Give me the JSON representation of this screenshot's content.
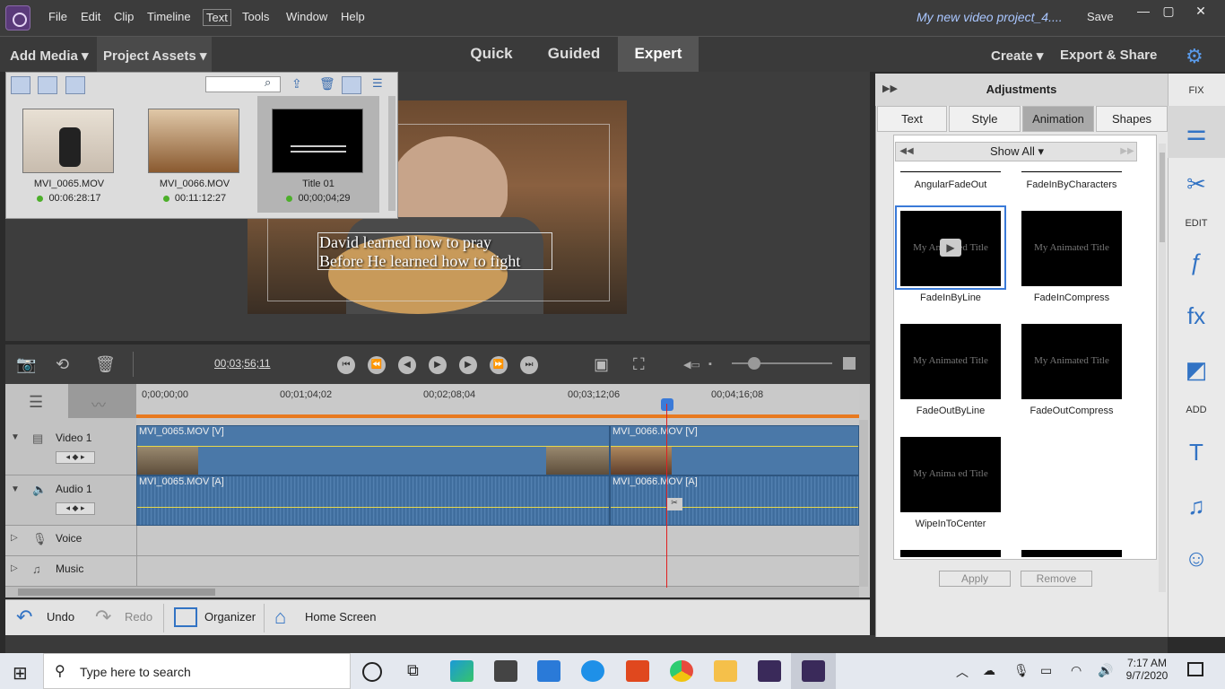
{
  "menu": {
    "items": [
      "File",
      "Edit",
      "Clip",
      "Timeline",
      "Text",
      "Tools",
      "Window",
      "Help"
    ],
    "project_title": "My new video project_4....",
    "save": "Save"
  },
  "modebar": {
    "add_media": "Add Media",
    "project_assets": "Project Assets",
    "tabs": [
      "Quick",
      "Guided",
      "Expert"
    ],
    "create": "Create",
    "export_share": "Export & Share"
  },
  "assets": [
    {
      "name": "MVI_0065.MOV",
      "duration": "00:06:28:17"
    },
    {
      "name": "MVI_0066.MOV",
      "duration": "00:11:12:27"
    },
    {
      "name": "Title 01",
      "duration": "00;00;04;29"
    }
  ],
  "preview": {
    "title_line1": "David learned how to pray",
    "title_line2": "Before He learned how to fight"
  },
  "transport": {
    "timecode": "00;03;56;11"
  },
  "ruler": [
    "0;00;00;00",
    "00;01;04;02",
    "00;02;08;04",
    "00;03;12;06",
    "00;04;16;08"
  ],
  "tracks": {
    "video1": "Video 1",
    "audio1": "Audio 1",
    "voice": "Voice",
    "music": "Music"
  },
  "clips": {
    "v1a": "MVI_0065.MOV [V]",
    "v1b": "MVI_0066.MOV [V]",
    "a1a": "MVI_0065.MOV [A]",
    "a1b": "MVI_0066.MOV [A]"
  },
  "actions": {
    "undo": "Undo",
    "redo": "Redo",
    "organizer": "Organizer",
    "home": "Home Screen"
  },
  "adjustments": {
    "title": "Adjustments",
    "tabs": [
      "Text",
      "Style",
      "Animation",
      "Shapes"
    ],
    "filter": "Show All",
    "top_labels": [
      "AngularFadeOut",
      "FadeInByCharacters"
    ],
    "presets": [
      {
        "label": "FadeInByLine",
        "thumb": "My Animated Title"
      },
      {
        "label": "FadeInCompress",
        "thumb": "My Animated Title"
      },
      {
        "label": "FadeOutByLine",
        "thumb": "My Animated Title"
      },
      {
        "label": "FadeOutCompress",
        "thumb": "My Animated Title"
      },
      {
        "label": "WipeInToCenter",
        "thumb": "My Anima ed Title"
      }
    ],
    "apply": "Apply",
    "remove": "Remove"
  },
  "tools": {
    "fix": "FIX",
    "edit": "EDIT",
    "add": "ADD"
  },
  "taskbar": {
    "search_placeholder": "Type here to search",
    "time": "7:17 AM",
    "date": "9/7/2020"
  },
  "colors": {
    "accent_blue": "#3273c4",
    "clip_blue": "#4a78a8",
    "playhead": "#e02020"
  }
}
